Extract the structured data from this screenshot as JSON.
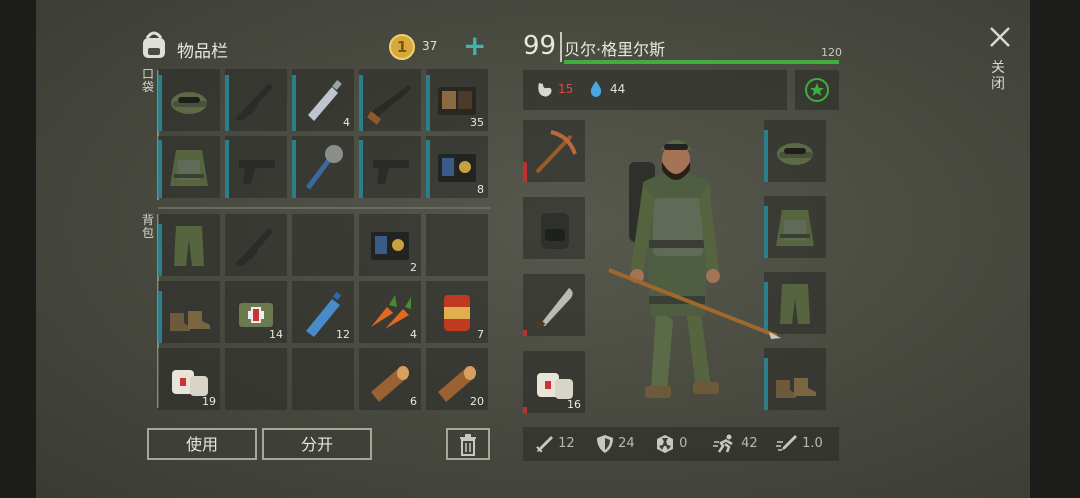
{
  "inventory": {
    "title": "物品栏",
    "coins": "37",
    "pockets_label": "口袋",
    "backpack_label": "背包"
  },
  "slots": {
    "pocket": [
      {
        "icon": "cap-icon",
        "count": ""
      },
      {
        "icon": "rifle-icon",
        "count": ""
      },
      {
        "icon": "bottle-icon",
        "count": "4"
      },
      {
        "icon": "shotgun-icon",
        "count": ""
      },
      {
        "icon": "wallet-icon",
        "count": "35"
      },
      {
        "icon": "vest-icon",
        "count": ""
      },
      {
        "icon": "pistol-icon",
        "count": ""
      },
      {
        "icon": "mace-icon",
        "count": ""
      },
      {
        "icon": "pistol-icon",
        "count": ""
      },
      {
        "icon": "badge-wallet-icon",
        "count": "8"
      }
    ],
    "backpack": [
      {
        "icon": "pants-icon",
        "count": ""
      },
      {
        "icon": "rifle-icon",
        "count": ""
      },
      {
        "icon": "empty",
        "count": ""
      },
      {
        "icon": "badge-wallet-icon",
        "count": "2"
      },
      {
        "icon": "empty",
        "count": ""
      },
      {
        "icon": "boots-icon",
        "count": ""
      },
      {
        "icon": "medkit-icon",
        "count": "14"
      },
      {
        "icon": "water-bottle-icon",
        "count": "12"
      },
      {
        "icon": "carrot-icon",
        "count": "4"
      },
      {
        "icon": "can-icon",
        "count": "7"
      },
      {
        "icon": "bandage-icon",
        "count": "19"
      },
      {
        "icon": "empty",
        "count": ""
      },
      {
        "icon": "empty",
        "count": ""
      },
      {
        "icon": "log-icon",
        "count": "6"
      },
      {
        "icon": "log-icon",
        "count": "20"
      }
    ]
  },
  "buttons": {
    "use": "使用",
    "split": "分开"
  },
  "character": {
    "level": "99",
    "name": "贝尔·格里尔斯",
    "health": "120",
    "health_fraction": 1.0,
    "food": "15",
    "water": "44"
  },
  "equip_left": [
    {
      "icon": "pickaxe-icon",
      "count": ""
    },
    {
      "icon": "backpack-icon",
      "count": ""
    },
    {
      "icon": "machete-icon",
      "count": ""
    },
    {
      "icon": "bandage-icon",
      "count": "16"
    }
  ],
  "equip_right": [
    {
      "icon": "cap-icon"
    },
    {
      "icon": "vest-icon"
    },
    {
      "icon": "pants-icon"
    },
    {
      "icon": "boots-icon"
    }
  ],
  "stats": {
    "attack": "12",
    "defense": "24",
    "radiation": "0",
    "speed": "42",
    "attack_speed": "1.0"
  },
  "close_label": "关闭",
  "colors": {
    "health": "#3fae3f",
    "food": "#e04848",
    "water": "#4aa8e0",
    "accent": "#2c7f8a"
  }
}
